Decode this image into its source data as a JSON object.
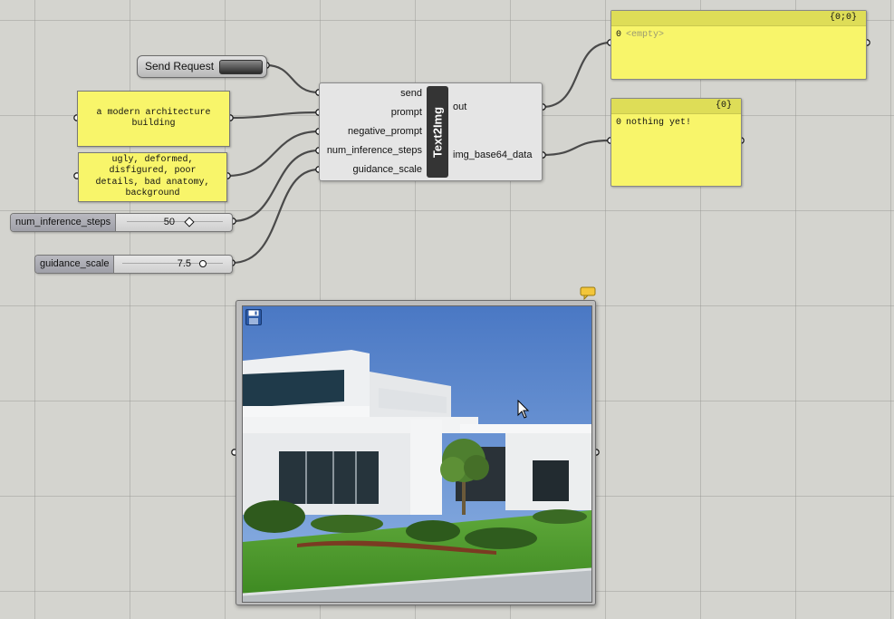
{
  "send_button": {
    "label": "Send Request"
  },
  "prompt_panel": {
    "text": "a modern architecture\nbuilding"
  },
  "negative_panel": {
    "text": "ugly, deformed,\ndisfigured, poor\ndetails, bad anatomy,\nbackground"
  },
  "slider_steps": {
    "name": "num_inference_steps",
    "value": "50",
    "fraction": 0.55
  },
  "slider_scale": {
    "name": "guidance_scale",
    "value": "7.5",
    "fraction": 0.72
  },
  "component": {
    "title": "Text2Img",
    "inputs": [
      "send",
      "prompt",
      "negative_prompt",
      "num_inference_steps",
      "guidance_scale"
    ],
    "outputs": [
      "out",
      "img_base64_data"
    ]
  },
  "out_panel": {
    "header": "{0;0}",
    "index": "0",
    "value": "<empty>"
  },
  "data_panel": {
    "header": "{0}",
    "index": "0",
    "value": "nothing yet!"
  },
  "icons": {
    "save": "save-icon",
    "bubble": "message-bubble-icon",
    "cursor": "mouse-cursor-icon"
  },
  "colors": {
    "panel": "#f8f56a",
    "canvas": "#d4d4cf",
    "wire": "#4a4a4a"
  }
}
